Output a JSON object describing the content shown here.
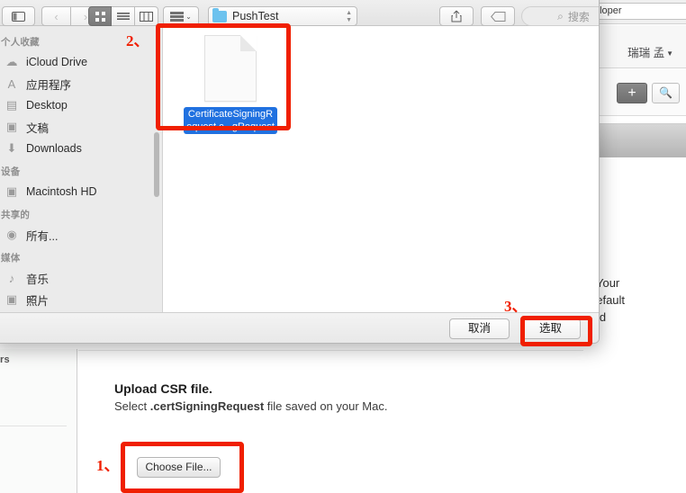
{
  "background": {
    "url_field_text": "eloper",
    "account_name": "瑞瑞 孟",
    "account_caret": "▼",
    "add_button_label": "+",
    "search_button_icon": "🔍",
    "right_text_line1": ". Your",
    "right_text_line2": "default",
    "right_text_line3": "ted",
    "left_label": "rs",
    "upload": {
      "title": "Upload CSR file.",
      "subtitle_prefix": "Select ",
      "subtitle_file_ext": ".certSigningRequest",
      "subtitle_suffix": " file saved on your Mac.",
      "choose_file_label": "Choose File..."
    }
  },
  "finder": {
    "toolbar": {
      "sidebar_toggle_icon": "sidebar-toggle-icon",
      "back_label": "‹",
      "forward_label": "›",
      "view_icon_label": "icon-view-icon",
      "view_list_label": "list-view-icon",
      "view_column_label": "column-view-icon",
      "arrange_caret": "⌄",
      "path_label": "PushTest",
      "stepper_up": "▲",
      "stepper_down": "▼",
      "share_icon": "⇧",
      "tag_icon": "tag-icon",
      "search_icon": "⌕",
      "search_placeholder": "搜索"
    },
    "sidebar": {
      "groups": [
        {
          "title": "个人收藏",
          "items": [
            {
              "label": "iCloud Drive",
              "icon": "☁"
            },
            {
              "label": "应用程序",
              "icon": "A"
            },
            {
              "label": "Desktop",
              "icon": "▤"
            },
            {
              "label": "文稿",
              "icon": "▣"
            },
            {
              "label": "Downloads",
              "icon": "⬇"
            }
          ]
        },
        {
          "title": "设备",
          "items": [
            {
              "label": "Macintosh HD",
              "icon": "▣"
            }
          ]
        },
        {
          "title": "共享的",
          "items": [
            {
              "label": "所有...",
              "icon": "◉"
            }
          ]
        },
        {
          "title": "媒体",
          "items": [
            {
              "label": "音乐",
              "icon": "♪"
            },
            {
              "label": "照片",
              "icon": "▣"
            }
          ]
        }
      ]
    },
    "file": {
      "name_line1": "CertificateSigningR",
      "name_line2": "equest.c...gRequest",
      "icon": "document-icon"
    },
    "footer": {
      "cancel_label": "取消",
      "choose_label": "选取"
    }
  },
  "annotations": {
    "step1": "1、",
    "step2": "2、",
    "step3": "3、",
    "color": "#f01f00"
  }
}
